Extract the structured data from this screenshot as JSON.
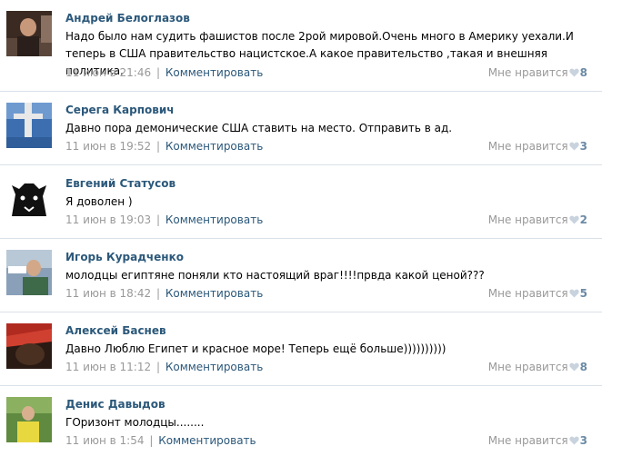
{
  "colors": {
    "author": "#2b587a",
    "meta": "#999999",
    "reply_link": "#2b587a",
    "like_count": "#6b8aa5",
    "heart": "#c8d3de",
    "divider": "#dae1e8"
  },
  "comments": [
    {
      "author": "Андрей Белоглазов",
      "text": "Надо было нам судить фашистов после 2рой мировой.Очень много в Америку уехали.И теперь в США правительство нацистское.А какое правительство ,такая и внешняя политика.",
      "date": "11 июн в 21:46",
      "separator": "|",
      "reply": "Комментировать",
      "like_label": "Мне нравится",
      "like_icon": "heart-icon",
      "likes": "8"
    },
    {
      "author": "Серега Карпович",
      "text": "Давно пора демонические США ставить на место. Отправить в ад.",
      "date": "11 июн в 19:52",
      "separator": "|",
      "reply": "Комментировать",
      "like_label": "Мне нравится",
      "like_icon": "heart-icon",
      "likes": "3"
    },
    {
      "author": "Евгений Статусов",
      "text": "Я доволен )",
      "date": "11 июн в 19:03",
      "separator": "|",
      "reply": "Комментировать",
      "like_label": "Мне нравится",
      "like_icon": "heart-icon",
      "likes": "2"
    },
    {
      "author": "Игорь Курадченко",
      "text": "молодцы египтяне поняли кто настоящий враг!!!!првда какой ценой???",
      "date": "11 июн в 18:42",
      "separator": "|",
      "reply": "Комментировать",
      "like_label": "Мне нравится",
      "like_icon": "heart-icon",
      "likes": "5"
    },
    {
      "author": "Алексей Баснев",
      "text": "Давно Люблю Египет и красное море! Теперь ещё больше))))))))))",
      "date": "11 июн в 11:12",
      "separator": "|",
      "reply": "Комментировать",
      "like_label": "Мне нравится",
      "like_icon": "heart-icon",
      "likes": "8"
    },
    {
      "author": "Денис Давыдов",
      "text": "ГОризонт молодцы........",
      "date": "11 июн в 1:54",
      "separator": "|",
      "reply": "Комментировать",
      "like_label": "Мне нравится",
      "like_icon": "heart-icon",
      "likes": "3"
    }
  ]
}
